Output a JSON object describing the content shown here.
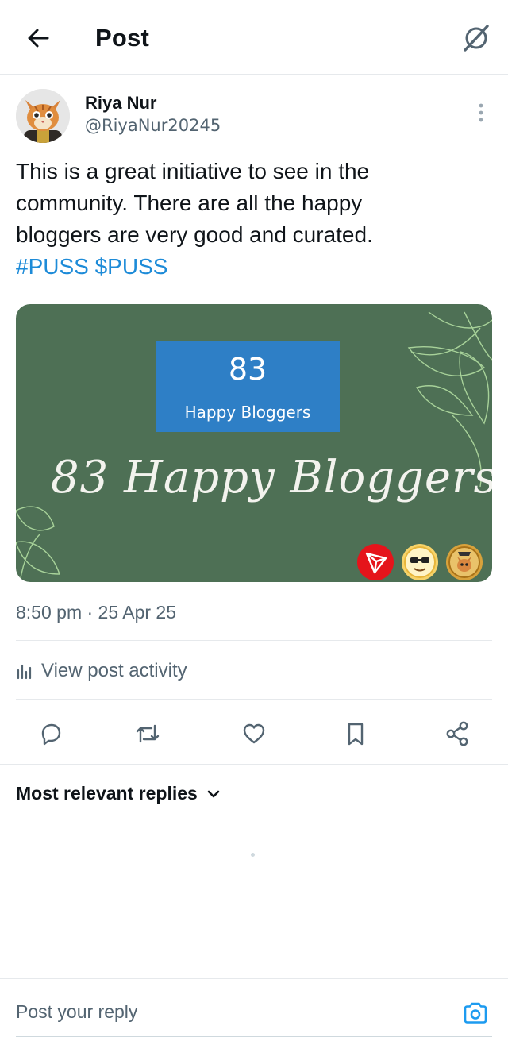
{
  "header": {
    "title": "Post"
  },
  "post": {
    "author_name": "Riya Nur",
    "author_handle": "@RiyaNur20245",
    "text_lines": [
      "This is a great initiative to see in the",
      "community.  There are all the happy",
      "bloggers are very good and curated."
    ],
    "hashtags": [
      "#PUSS",
      "$PUSS"
    ],
    "media": {
      "count": "83",
      "count_label": "Happy Bloggers",
      "script_title": "83 Happy Bloggers",
      "background_color": "#4e7055",
      "box_color": "#2e7fc6"
    },
    "timestamp": "8:50 pm · 25 Apr 25",
    "activity_label": "View post activity"
  },
  "actions": [
    "reply-icon",
    "repost-icon",
    "like-icon",
    "bookmark-icon",
    "share-icon"
  ],
  "replies": {
    "sort_label": "Most relevant replies"
  },
  "reply_bar": {
    "placeholder": "Post your reply"
  },
  "colors": {
    "accent": "#1d9bf0",
    "text": "#0f1419",
    "muted": "#536471"
  }
}
